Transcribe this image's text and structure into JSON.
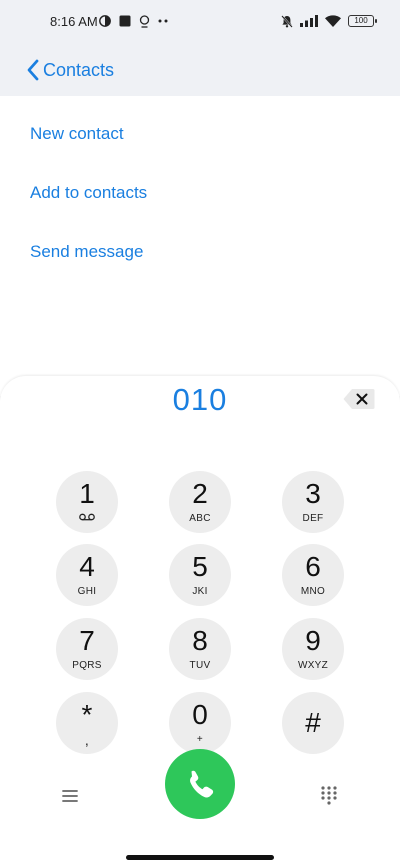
{
  "status_bar": {
    "time": "8:16 AM",
    "battery": "100",
    "icons": [
      "vpn-icon",
      "square-icon",
      "location-icon",
      "more-dots-icon",
      "mute-bell-icon",
      "signal-icon",
      "wifi-icon",
      "battery-icon"
    ]
  },
  "header": {
    "back_label": "Contacts"
  },
  "actions": [
    {
      "label": "New contact"
    },
    {
      "label": "Add to contacts"
    },
    {
      "label": "Send message"
    }
  ],
  "dialpad": {
    "number": "010",
    "keys": [
      {
        "digit": "1",
        "letters": ""
      },
      {
        "digit": "2",
        "letters": "ABC"
      },
      {
        "digit": "3",
        "letters": "DEF"
      },
      {
        "digit": "4",
        "letters": "GHI"
      },
      {
        "digit": "5",
        "letters": "JKI"
      },
      {
        "digit": "6",
        "letters": "MNO"
      },
      {
        "digit": "7",
        "letters": "PQRS"
      },
      {
        "digit": "8",
        "letters": "TUV"
      },
      {
        "digit": "9",
        "letters": "WXYZ"
      },
      {
        "digit": "*",
        "letters": ","
      },
      {
        "digit": "0",
        "letters": "+"
      },
      {
        "digit": "#",
        "letters": ""
      }
    ]
  },
  "colors": {
    "accent": "#1a7fe0",
    "call": "#2ec75a",
    "key_bg": "#ededed",
    "header_bg": "#eff1f5"
  }
}
